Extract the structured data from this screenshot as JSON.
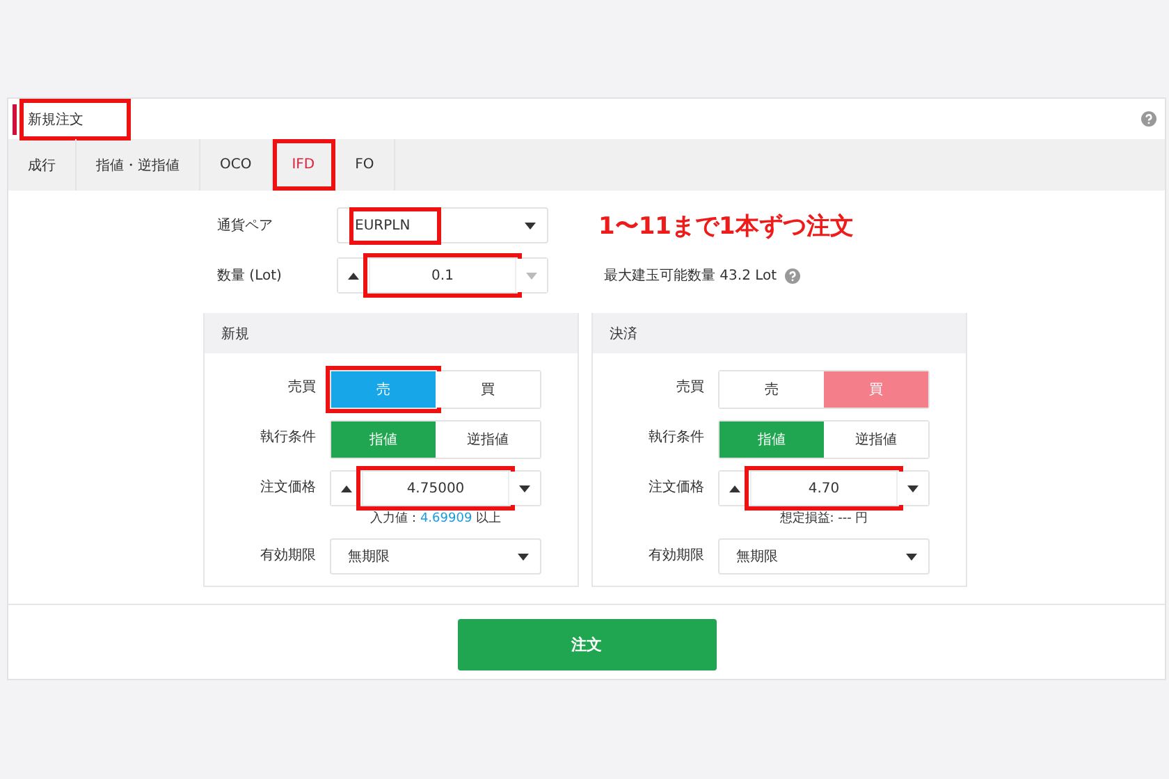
{
  "title": {
    "text": "新規注文",
    "highlighted": true
  },
  "tabs": [
    {
      "label": "成行",
      "selected": false,
      "highlighted": false
    },
    {
      "label": "指値・逆指値",
      "selected": false,
      "highlighted": false
    },
    {
      "label": "OCO",
      "selected": false,
      "highlighted": false
    },
    {
      "label": "IFD",
      "selected": true,
      "highlighted": true
    },
    {
      "label": "FO",
      "selected": false,
      "highlighted": false
    }
  ],
  "annotation_note": "1〜11まで1本ずつ注文",
  "currency_pair": {
    "label": "通貨ペア",
    "value": "EURPLN",
    "highlighted": true
  },
  "quantity": {
    "label": "数量 (Lot)",
    "value": "0.1",
    "highlighted": true,
    "decrement_disabled": true
  },
  "max_position": "最大建玉可能数量 43.2 Lot",
  "panels": [
    {
      "title": "新規",
      "side": {
        "label": "売買",
        "options": [
          {
            "label": "売",
            "selected": true,
            "highlighted": true
          },
          {
            "label": "買",
            "selected": false,
            "highlighted": false
          }
        ]
      },
      "execution": {
        "label": "執行条件",
        "options": [
          {
            "label": "指値",
            "selected": true,
            "highlighted": false
          },
          {
            "label": "逆指値",
            "selected": false,
            "highlighted": false
          }
        ]
      },
      "price": {
        "label": "注文価格",
        "value": "4.75000",
        "highlighted": true,
        "hint": [
          {
            "text": "入力値：",
            "accent": false
          },
          {
            "text": "4.69909",
            "accent": true
          },
          {
            "text": " 以上",
            "accent": false
          }
        ]
      },
      "expiry": {
        "label": "有効期限",
        "value": "無期限"
      }
    },
    {
      "title": "決済",
      "side": {
        "label": "売買",
        "options": [
          {
            "label": "売",
            "selected": false,
            "highlighted": false
          },
          {
            "label": "買",
            "selected": true,
            "highlighted": false
          }
        ]
      },
      "execution": {
        "label": "執行条件",
        "options": [
          {
            "label": "指値",
            "selected": true,
            "highlighted": false
          },
          {
            "label": "逆指値",
            "selected": false,
            "highlighted": false
          }
        ]
      },
      "price": {
        "label": "注文価格",
        "value": "4.70",
        "highlighted": true,
        "hint": [
          {
            "text": "想定損益: --- 円",
            "accent": false
          }
        ]
      },
      "expiry": {
        "label": "有効期限",
        "value": "無期限"
      }
    }
  ],
  "submit": "注文"
}
